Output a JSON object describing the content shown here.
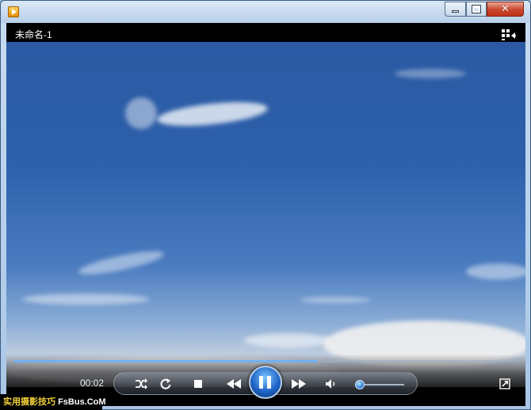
{
  "window": {
    "caption_buttons": {
      "minimize": "minimize-icon",
      "maximize": "maximize-icon",
      "close": "close-icon",
      "close_glyph": "✕"
    }
  },
  "player": {
    "media_title": "未命名-1",
    "elapsed_time": "00:02",
    "seek_progress": 0.6,
    "volume_level": 0.1,
    "paused_state_icon": "pause-icon",
    "icons": [
      "switch-to-library-icon",
      "shuffle-icon",
      "repeat-icon",
      "stop-icon",
      "previous-icon",
      "pause-icon",
      "next-icon",
      "mute-icon",
      "fullscreen-icon"
    ]
  },
  "overlay": {
    "watermark_brand": "实用摄影技巧",
    "watermark_site": "FsBus.CoM"
  },
  "colors": {
    "accent": "#6fb2f1",
    "close_button": "#c8452c",
    "watermark_text": "#f5d23a"
  }
}
